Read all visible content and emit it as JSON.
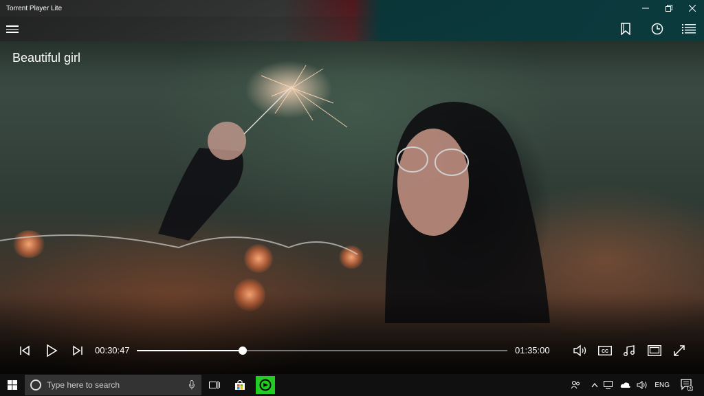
{
  "window": {
    "title": "Torrent Player Lite",
    "controls": {
      "minimize": "—",
      "maximize": "❐",
      "close": "✕"
    }
  },
  "player": {
    "video_title": "Beautiful girl",
    "current_time": "00:30:47",
    "total_time": "01:35:00",
    "progress": 0.285
  },
  "appbar": {
    "icons": [
      "bookmark-icon",
      "history-icon",
      "playlist-icon"
    ]
  },
  "controls": {
    "left": [
      "previous-icon",
      "play-icon",
      "next-icon"
    ],
    "right": [
      "volume-icon",
      "captions-icon",
      "audio-track-icon",
      "picture-in-picture-icon",
      "fullscreen-icon"
    ]
  },
  "taskbar": {
    "search_placeholder": "Type here to search",
    "language": "ENG",
    "notification_count": "3"
  },
  "colors": {
    "accent": "#0b3a3d",
    "active_app": "#22cc22"
  }
}
